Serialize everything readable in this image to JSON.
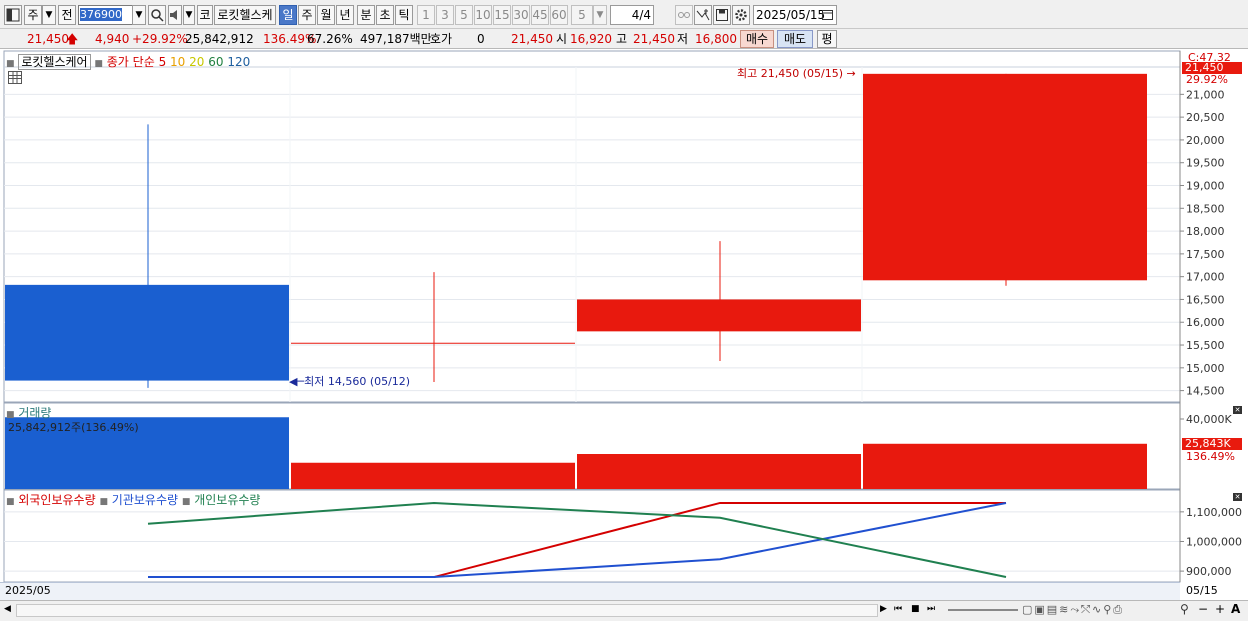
{
  "toolbar": {
    "period_main": "주",
    "prev_label": "전",
    "stock_code": "376900",
    "market_badge": "코",
    "stock_name": "로킷헬스케",
    "periods": [
      "일",
      "주",
      "월",
      "년",
      "분",
      "초",
      "틱"
    ],
    "selected_period": "일",
    "intervals": [
      "1",
      "3",
      "5",
      "10",
      "15",
      "30",
      "45",
      "60"
    ],
    "interval_value": "5",
    "page": "4/4",
    "date": "2025/05/15"
  },
  "quote": {
    "price": "21,450",
    "change": "4,940",
    "change_pct": "+29.92%",
    "volume": "25,842,912",
    "volume_pct": "136.49%",
    "turnover": "67.26%",
    "amount": "497,187백만",
    "hoga_label": "호가",
    "hoga_value": "0",
    "hoga_price": "21,450",
    "open_label": "시",
    "open": "16,920",
    "high_label": "고",
    "high": "21,450",
    "low_label": "저",
    "low": "16,800",
    "buy": "매수",
    "sell": "매도",
    "eval": "평"
  },
  "price_panel": {
    "name": "로킷헬스케어",
    "ma_label": "종가 단순",
    "ma_periods": [
      "5",
      "10",
      "20",
      "60",
      "120"
    ],
    "ma_colors": [
      "#d40000",
      "#e8a000",
      "#c8c800",
      "#208040",
      "#2060a0"
    ],
    "corner": "C:47.32",
    "current_tag": "21,450",
    "current_pct": "29.92%",
    "high_note": "최고 21,450 (05/15)",
    "low_note": "최저 14,560 (05/12)",
    "y_ticks": [
      "21,000",
      "20,500",
      "20,000",
      "19,500",
      "19,000",
      "18,500",
      "18,000",
      "17,500",
      "17,000",
      "16,500",
      "16,000",
      "15,500",
      "15,000",
      "14,500"
    ]
  },
  "volume_panel": {
    "title": "거래량",
    "value_note": "25,842,912주(136.49%)",
    "y_tick": "40,000K",
    "current_tag": "25,843K",
    "current_pct": "136.49%"
  },
  "holding_panel": {
    "series_labels": [
      "외국인보유수량",
      "기관보유수량",
      "개인보유수량"
    ],
    "series_colors": [
      "#d40000",
      "#2050d0",
      "#208050"
    ],
    "y_ticks": [
      "1,100,000",
      "1,000,000",
      "900,000"
    ]
  },
  "xaxis": {
    "left_label": "2025/05",
    "right_label": "05/15"
  },
  "chart_data": {
    "type": "candlestick",
    "candles": [
      {
        "open": 16820,
        "high": 20340,
        "low": 14560,
        "close": 14720,
        "color": "#1a5fd0"
      },
      {
        "open": 15550,
        "high": 17100,
        "low": 14690,
        "close": 15530,
        "color": "#e8190e"
      },
      {
        "open": 15800,
        "high": 17780,
        "low": 15150,
        "close": 16500,
        "color": "#e8190e"
      },
      {
        "open": 16920,
        "high": 21450,
        "low": 16800,
        "close": 21450,
        "color": "#e8190e"
      }
    ],
    "volume": [
      {
        "value": 41000,
        "color": "#1a5fd0"
      },
      {
        "value": 15000,
        "color": "#e8190e"
      },
      {
        "value": 20000,
        "color": "#e8190e"
      },
      {
        "value": 25843,
        "color": "#e8190e"
      }
    ],
    "holding": {
      "foreign": [
        880000,
        880000,
        1130000,
        1130000
      ],
      "institution": [
        880000,
        880000,
        940000,
        1130000
      ],
      "individual": [
        1060000,
        1130000,
        1080000,
        880000
      ]
    }
  }
}
